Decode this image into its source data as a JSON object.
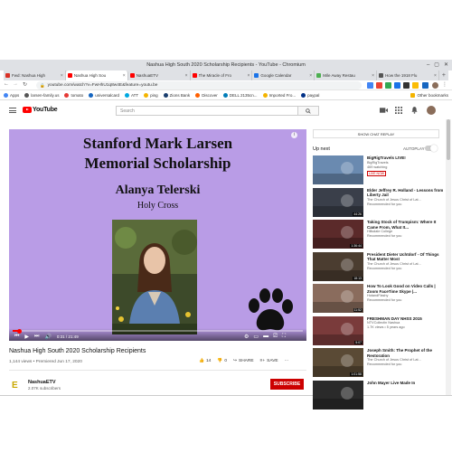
{
  "window": {
    "title": "Nashua High South 2020 Scholarship Recipients - YouTube - Chromium",
    "controls": [
      "–",
      "▢",
      "✕"
    ]
  },
  "tabs": [
    {
      "label": "Fwd: Nashua High",
      "color": "#d93025"
    },
    {
      "label": "Nashua High Sou",
      "color": "#ff0000",
      "active": true
    },
    {
      "label": "NashuaETV",
      "color": "#ff0000"
    },
    {
      "label": "The Miracle of Fro",
      "color": "#ff0000"
    },
    {
      "label": "Google Calendar",
      "color": "#1a73e8"
    },
    {
      "label": "Mile Away Restau",
      "color": "#4caf50"
    },
    {
      "label": "How the 1918 Flu",
      "color": "#555555"
    }
  ],
  "nav": {
    "back": "←",
    "forward": "→",
    "reload": "↻",
    "lock": "🔒"
  },
  "url": "youtube.com/watch?v=FwHhU1q8w4E&feature=youtu.be",
  "bookmarks": [
    {
      "label": "Apps",
      "color": "#4285f4"
    },
    {
      "label": "larsen-family.us",
      "color": "#555555"
    },
    {
      "label": "tomato",
      "color": "#e53935"
    },
    {
      "label": "universalcard",
      "color": "#1565c0"
    },
    {
      "label": "ATT",
      "color": "#00a8e0"
    },
    {
      "label": "ping",
      "color": "#f4b400"
    },
    {
      "label": "Zions Bank",
      "color": "#1a3e6e"
    },
    {
      "label": "Discover",
      "color": "#ff6000"
    },
    {
      "label": "DELL 2135cn...",
      "color": "#007db8"
    },
    {
      "label": "Imported Fro...",
      "color": "#f4b400"
    },
    {
      "label": "paypal",
      "color": "#003087"
    }
  ],
  "other_bookmarks": "Other bookmarks",
  "youtube": {
    "logo": "YouTube",
    "search_placeholder": "Search"
  },
  "video": {
    "slide_title_line1": "Stanford Mark Larsen",
    "slide_title_line2": "Memorial Scholarship",
    "slide_name": "Alanya Telerski",
    "slide_school": "Holy Cross",
    "time": "0:31 / 21:49",
    "progress": 0.024,
    "title": "Nashua High South 2020 Scholarship Recipients",
    "meta": "1,144 views • Premiered Jun 17, 2020",
    "likes": "14",
    "dislikes": "0",
    "share": "SHARE",
    "save": "SAVE"
  },
  "channel": {
    "name": "NashuaETV",
    "subs": "2.07K subscribers",
    "subscribe": "SUBSCRIBE"
  },
  "sidebar": {
    "chat_replay": "SHOW CHAT REPLAY",
    "up_next": "Up next",
    "autoplay": "AUTOPLAY",
    "items": [
      {
        "title": "BigRigTravels LIVE!",
        "channel": "BigRigTravels",
        "meta": "469 watching",
        "badge": "LIVE NOW",
        "duration": "",
        "bg": "#6a8ab0"
      },
      {
        "title": "Elder Jeffrey R. Holland - Lessons from Liberty Jail",
        "channel": "The Church of Jesus Christ of Lat...",
        "meta": "Recommended for you",
        "duration": "44:26",
        "bg": "#3a3f4a"
      },
      {
        "title": "Taking Stock of Trumpism: Where It Came From, What It...",
        "channel": "Hillsdale College",
        "meta": "Recommended for you",
        "duration": "1:36:44",
        "bg": "#5b2a2a"
      },
      {
        "title": "President Dieter Uchtdorf - Of Things That Matter Most",
        "channel": "The Church of Jesus Christ of Lat...",
        "meta": "Recommended for you",
        "duration": "18:13",
        "bg": "#4b3d30"
      },
      {
        "title": "How To Look Good on Video Calls | Zoom FaceTime Skype |...",
        "channel": "HotandFlashy",
        "meta": "Recommended for you",
        "duration": "11:52",
        "bg": "#8a6c5d"
      },
      {
        "title": "FRESHMAN DAY NHSS 2015",
        "channel": "NTVCollectin Nashua",
        "meta": "1.7K views • 5 years ago",
        "duration": "5:07",
        "bg": "#7a3b3b"
      },
      {
        "title": "Joseph Smith: The Prophet of the Restoration",
        "channel": "The Church of Jesus Christ of Lat...",
        "meta": "Recommended for you",
        "duration": "1:01:58",
        "bg": "#5a4a35"
      },
      {
        "title": "John Mayer Live Made In",
        "channel": "",
        "meta": "",
        "duration": "",
        "bg": "#2a2a2a"
      }
    ]
  }
}
